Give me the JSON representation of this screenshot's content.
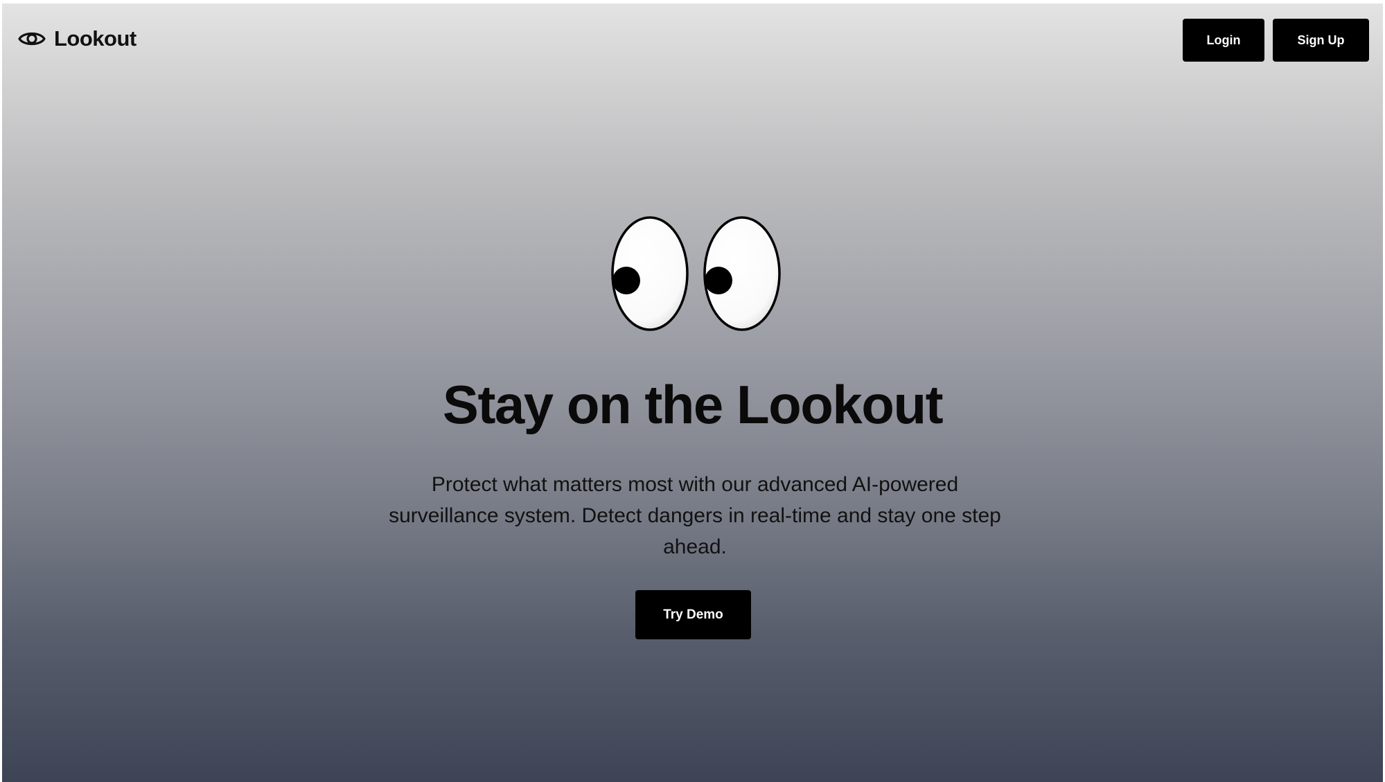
{
  "header": {
    "brand_icon": "eye-icon",
    "brand_name": "Lookout",
    "login_label": "Login",
    "signup_label": "Sign Up"
  },
  "hero": {
    "illustration": "googly-eyes-illustration",
    "title": "Stay on the Lookout",
    "description": "Protect what matters most with our advanced AI-powered surveillance system. Detect dangers in real-time and stay one step ahead.",
    "cta_label": "Try Demo"
  },
  "colors": {
    "gradient_top": "#e4e3e3",
    "gradient_bottom": "#3d4455",
    "button_bg": "#000000",
    "button_text": "#ffffff",
    "text": "#111111"
  }
}
